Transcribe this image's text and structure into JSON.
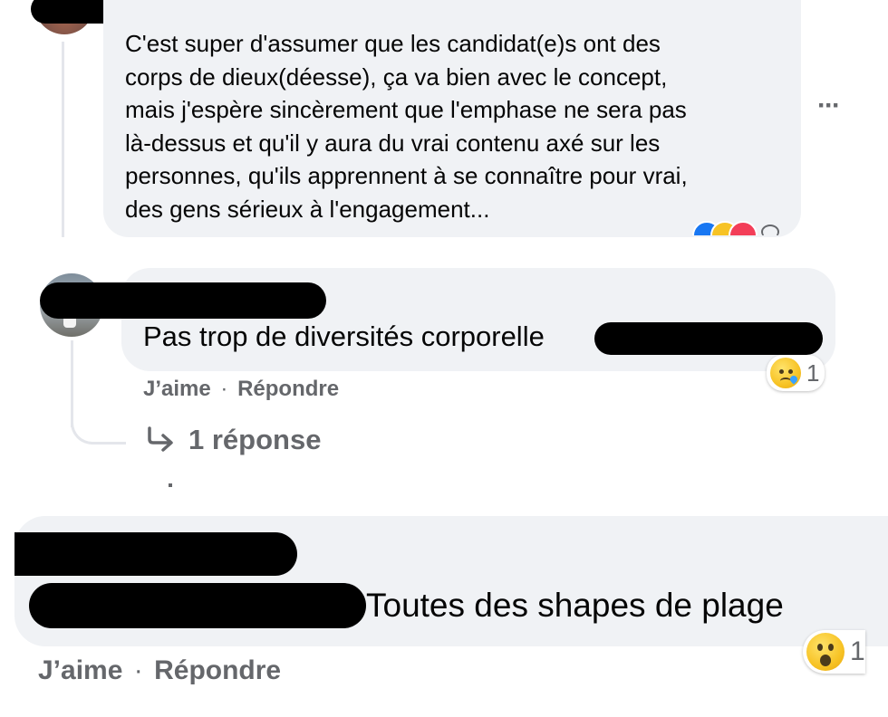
{
  "comments": [
    {
      "text_lines": [
        "C'est super d'assumer que les candidat(e)s ont des",
        "corps de dieux(déesse), ça va bien avec le concept,",
        "mais j'espère sincèrement que l'emphase ne sera pas",
        "là-dessus et qu'il y aura du vrai contenu axé sur les",
        "personnes, qu'ils apprennent à se connaître pour vrai,",
        "des gens sérieux à l'engagement..."
      ],
      "more_options": "···",
      "reaction_icons": [
        "like-icon",
        "laugh-icon",
        "heart-icon"
      ]
    },
    {
      "text": "Pas trop de diversités corporelle",
      "reaction_icon": "sad-face-icon",
      "reaction_count": "1",
      "like_label": "J’aime",
      "separator": "·",
      "reply_label": "Répondre",
      "replies_icon": "reply-arrow-icon",
      "replies_label": "1 réponse"
    },
    {
      "text": "Toutes des shapes de plage",
      "reaction_icon": "wow-face-icon",
      "reaction_count": "1",
      "like_label": "J’aime",
      "separator": "·",
      "reply_label": "Répondre"
    }
  ],
  "colors": {
    "bubble": "#f0f2f5",
    "meta_text": "#65676b",
    "text": "#050505",
    "redaction": "#000000",
    "thread_line": "#e4e6eb"
  }
}
